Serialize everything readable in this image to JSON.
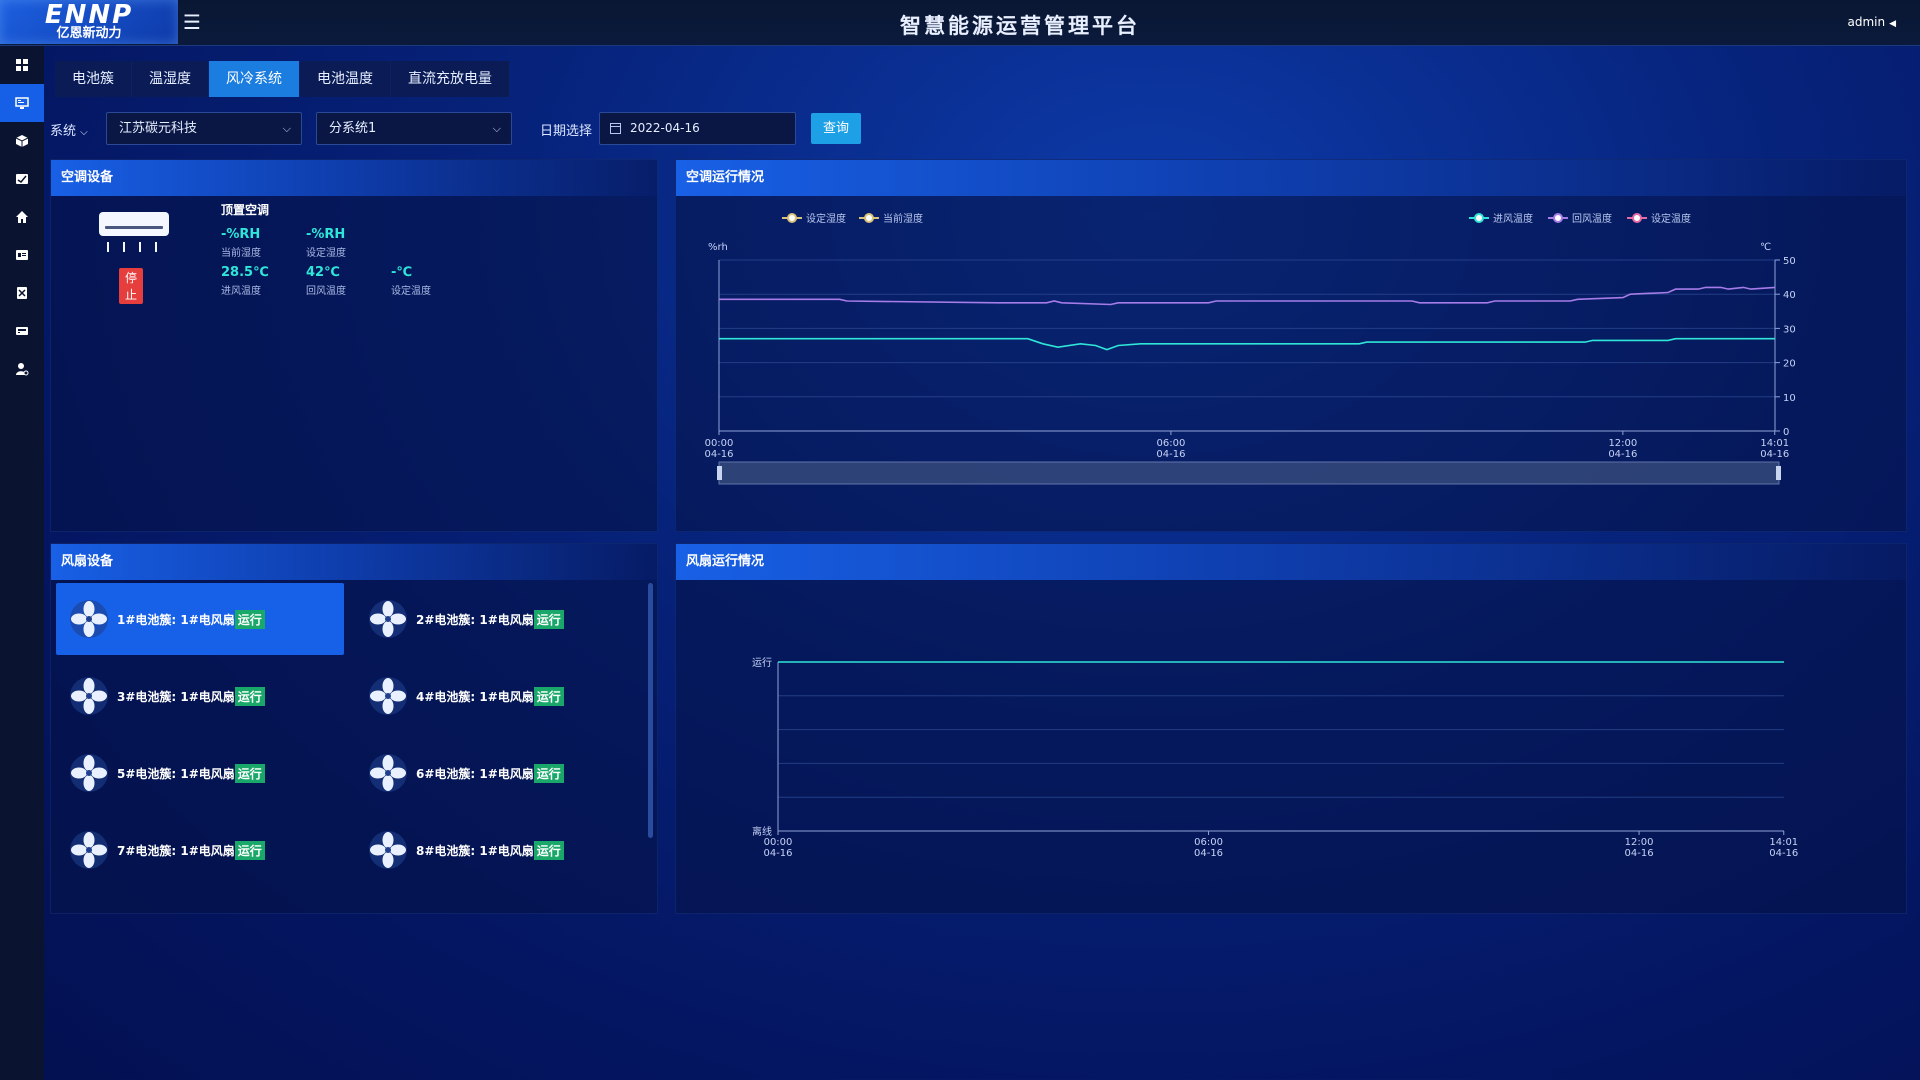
{
  "header": {
    "logo_mark": "ENNP",
    "logo_sub": "亿恩新动力",
    "title": "智慧能源运营管理平台",
    "user": "admin"
  },
  "sidebar": {
    "items": [
      {
        "icon": "dashboard-icon"
      },
      {
        "icon": "monitor-icon",
        "active": true
      },
      {
        "icon": "box-icon"
      },
      {
        "icon": "report-icon"
      },
      {
        "icon": "home-icon"
      },
      {
        "icon": "id-card-icon"
      },
      {
        "icon": "document-icon"
      },
      {
        "icon": "device-icon"
      },
      {
        "icon": "user-settings-icon"
      }
    ]
  },
  "tabs": [
    {
      "label": "电池簇"
    },
    {
      "label": "温湿度"
    },
    {
      "label": "风冷系统",
      "active": true
    },
    {
      "label": "电池温度"
    },
    {
      "label": "直流充放电量"
    }
  ],
  "filters": {
    "system_label": "系统",
    "company": "江苏碳元科技",
    "subsystem": "分系统1",
    "date_label": "日期选择",
    "date": "2022-04-16",
    "query_button": "查询"
  },
  "ac_panel": {
    "title": "空调设备",
    "device_name": "顶置空调",
    "status": "停止",
    "current_humidity": {
      "value": "-%RH",
      "label": "当前湿度"
    },
    "set_humidity": {
      "value": "-%RH",
      "label": "设定湿度"
    },
    "inlet_temp": {
      "value": "28.5℃",
      "label": "进风温度"
    },
    "return_temp": {
      "value": "42℃",
      "label": "回风温度"
    },
    "set_temp": {
      "value": "-℃",
      "label": "设定温度"
    }
  },
  "ac_chart_panel": {
    "title": "空调运行情况"
  },
  "fan_panel": {
    "title": "风扇设备",
    "status_label": "运行",
    "fans": [
      {
        "label": "1#电池簇: 1#电风扇",
        "active": true
      },
      {
        "label": "2#电池簇: 1#电风扇"
      },
      {
        "label": "3#电池簇: 1#电风扇"
      },
      {
        "label": "4#电池簇: 1#电风扇"
      },
      {
        "label": "5#电池簇: 1#电风扇"
      },
      {
        "label": "6#电池簇: 1#电风扇"
      },
      {
        "label": "7#电池簇: 1#电风扇"
      },
      {
        "label": "8#电池簇: 1#电风扇"
      }
    ]
  },
  "fan_chart_panel": {
    "title": "风扇运行情况"
  },
  "colors": {
    "accent": "#1b7de0",
    "teal": "#2fe6d8",
    "purple": "#a57ce8",
    "stop": "#e63d3d",
    "run": "#1aa86a"
  },
  "chart_data": [
    {
      "type": "line",
      "left_axis_label": "%rh",
      "right_axis_label": "℃",
      "legend_left": [
        "设定湿度",
        "当前湿度"
      ],
      "legend_right": [
        "进风温度",
        "回风温度",
        "设定温度"
      ],
      "x_ticks": [
        {
          "time": "00:00",
          "date": "04-16"
        },
        {
          "time": "06:00",
          "date": "04-16"
        },
        {
          "time": "12:00",
          "date": "04-16"
        },
        {
          "time": "14:01",
          "date": "04-16"
        }
      ],
      "x_range_hours": [
        0,
        14.02
      ],
      "y_right_ticks": [
        0,
        10,
        20,
        30,
        40,
        50
      ],
      "ylim_right": [
        0,
        50
      ],
      "series": [
        {
          "name": "回风温度",
          "color": "#a57ce8",
          "x": [
            0,
            1.6,
            1.7,
            3.7,
            4.35,
            4.45,
            4.55,
            5.2,
            5.3,
            6.5,
            6.6,
            9.2,
            9.3,
            10.2,
            10.3,
            11.3,
            11.4,
            12.0,
            12.1,
            12.6,
            12.7,
            13.0,
            13.1,
            13.3,
            13.4,
            13.6,
            13.7,
            14.02
          ],
          "y": [
            38.5,
            38.5,
            38,
            37.5,
            37.5,
            38,
            37.5,
            37,
            37.5,
            37.5,
            38,
            38,
            37.5,
            37.5,
            38,
            38,
            38.5,
            39,
            40,
            40.5,
            41.5,
            41.5,
            42,
            42,
            41.5,
            42,
            41.5,
            42
          ]
        },
        {
          "name": "进风温度",
          "color": "#2fe6d8",
          "x": [
            0,
            4.0,
            4.1,
            4.3,
            4.5,
            4.8,
            5.0,
            5.15,
            5.3,
            5.6,
            6.0,
            8.5,
            8.6,
            11.5,
            11.6,
            12.6,
            12.7,
            14.02
          ],
          "y": [
            27,
            27,
            27,
            25.5,
            24.5,
            25.5,
            25,
            23.8,
            25,
            25.5,
            25.5,
            25.5,
            26,
            26,
            26.5,
            26.5,
            27,
            27
          ]
        }
      ]
    },
    {
      "type": "line",
      "y_categories": [
        "运行",
        "离线"
      ],
      "x_ticks": [
        {
          "time": "00:00",
          "date": "04-16"
        },
        {
          "time": "06:00",
          "date": "04-16"
        },
        {
          "time": "12:00",
          "date": "04-16"
        },
        {
          "time": "14:01",
          "date": "04-16"
        }
      ],
      "x_range_hours": [
        0,
        14.02
      ],
      "series": [
        {
          "name": "1#电池簇: 1#电风扇",
          "color": "#2fe6d8",
          "x": [
            0,
            14.02
          ],
          "y": [
            "运行",
            "运行"
          ]
        }
      ]
    }
  ]
}
